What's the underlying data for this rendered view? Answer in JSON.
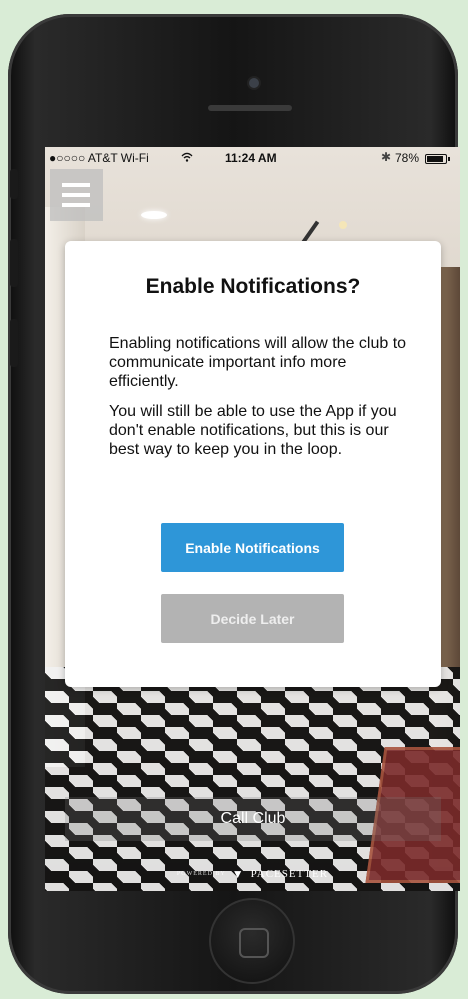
{
  "status_bar": {
    "carrier": "●○○○○ AT&T Wi-Fi",
    "time": "11:24 AM",
    "battery_percent": "78%"
  },
  "icons": {
    "menu": "hamburger-menu-icon",
    "wifi": "wifi-icon",
    "bluetooth": "bluetooth-icon",
    "battery": "battery-icon",
    "logo": "pacesetter-logo-icon"
  },
  "modal": {
    "title": "Enable Notifications?",
    "paragraph1": "Enabling notifications will allow the club to communicate important info more efficiently.",
    "paragraph2": "You will still be able to use the App if you don't enable notifications, but this is our best way to keep you in the loop.",
    "enable_button": "Enable Notifications",
    "later_button": "Decide Later"
  },
  "footer": {
    "call_club": "Call Club",
    "powered_by": "POWERED BY",
    "brand": "PACESETTER"
  },
  "colors": {
    "primary_button": "#2e96d8",
    "secondary_button": "#b3b3b3",
    "background": "#d9ecd6"
  }
}
